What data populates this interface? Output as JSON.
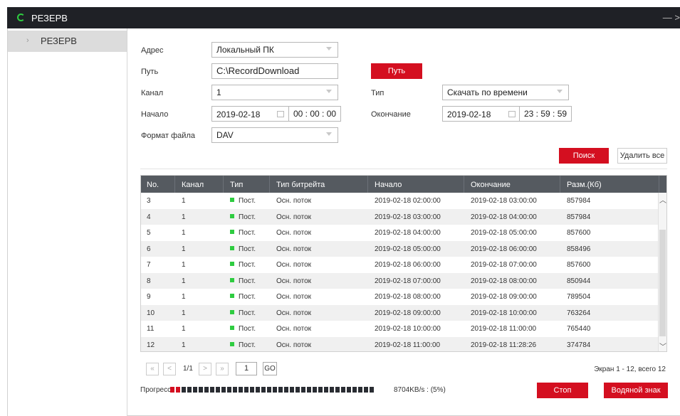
{
  "window": {
    "title": "РЕЗЕРВ",
    "controls": "— >"
  },
  "sidebar": {
    "items": [
      {
        "label": "РЕЗЕРВ"
      }
    ]
  },
  "form": {
    "address_label": "Адрес",
    "address_value": "Локальный ПК",
    "path_label": "Путь",
    "path_value": "C:\\RecordDownload",
    "path_button": "Путь",
    "channel_label": "Канал",
    "channel_value": "1",
    "type_label": "Тип",
    "type_value": "Скачать по времени",
    "start_label": "Начало",
    "start_date": "2019-02-18",
    "start_time": "00 : 00 : 00",
    "end_label": "Окончание",
    "end_date": "2019-02-18",
    "end_time": "23 : 59 : 59",
    "format_label": "Формат файла",
    "format_value": "DAV",
    "search_button": "Поиск",
    "delete_all_button": "Удалить все"
  },
  "table": {
    "columns": [
      "No.",
      "Канал",
      "Тип",
      "Тип битрейта",
      "Начало",
      "Окончание",
      "Разм.(Кб)"
    ],
    "rows": [
      {
        "no": "3",
        "channel": "1",
        "type": "Пост.",
        "bitrate": "Осн. поток",
        "start": "2019-02-18 02:00:00",
        "end": "2019-02-18 03:00:00",
        "size": "857984"
      },
      {
        "no": "4",
        "channel": "1",
        "type": "Пост.",
        "bitrate": "Осн. поток",
        "start": "2019-02-18 03:00:00",
        "end": "2019-02-18 04:00:00",
        "size": "857984"
      },
      {
        "no": "5",
        "channel": "1",
        "type": "Пост.",
        "bitrate": "Осн. поток",
        "start": "2019-02-18 04:00:00",
        "end": "2019-02-18 05:00:00",
        "size": "857600"
      },
      {
        "no": "6",
        "channel": "1",
        "type": "Пост.",
        "bitrate": "Осн. поток",
        "start": "2019-02-18 05:00:00",
        "end": "2019-02-18 06:00:00",
        "size": "858496"
      },
      {
        "no": "7",
        "channel": "1",
        "type": "Пост.",
        "bitrate": "Осн. поток",
        "start": "2019-02-18 06:00:00",
        "end": "2019-02-18 07:00:00",
        "size": "857600"
      },
      {
        "no": "8",
        "channel": "1",
        "type": "Пост.",
        "bitrate": "Осн. поток",
        "start": "2019-02-18 07:00:00",
        "end": "2019-02-18 08:00:00",
        "size": "850944"
      },
      {
        "no": "9",
        "channel": "1",
        "type": "Пост.",
        "bitrate": "Осн. поток",
        "start": "2019-02-18 08:00:00",
        "end": "2019-02-18 09:00:00",
        "size": "789504"
      },
      {
        "no": "10",
        "channel": "1",
        "type": "Пост.",
        "bitrate": "Осн. поток",
        "start": "2019-02-18 09:00:00",
        "end": "2019-02-18 10:00:00",
        "size": "763264"
      },
      {
        "no": "11",
        "channel": "1",
        "type": "Пост.",
        "bitrate": "Осн. поток",
        "start": "2019-02-18 10:00:00",
        "end": "2019-02-18 11:00:00",
        "size": "765440"
      },
      {
        "no": "12",
        "channel": "1",
        "type": "Пост.",
        "bitrate": "Осн. поток",
        "start": "2019-02-18 11:00:00",
        "end": "2019-02-18 11:28:26",
        "size": "374784"
      }
    ]
  },
  "pager": {
    "first": "«",
    "prev": "<",
    "next": ">",
    "last": "»",
    "page_info": "1/1",
    "page_input": "1",
    "go_label": "GO",
    "summary": "Экран 1 - 12, всего 12"
  },
  "progress": {
    "label": "Прогресс:",
    "percent": 5,
    "text": "8704KB/s : (5%)",
    "stop_button": "Стоп",
    "watermark_button": "Водяной знак"
  },
  "colors": {
    "accent": "#d40f20",
    "titlebar": "#1f2126",
    "table_header": "#555a60",
    "record_dot": "#2ecc40"
  }
}
